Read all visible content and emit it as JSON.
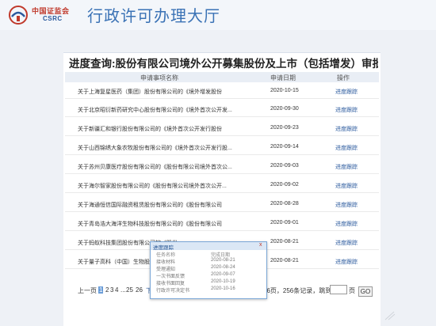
{
  "header": {
    "logo_cn": "中国证监会",
    "logo_en": "CSRC",
    "app_title": "行政许可办理大厅"
  },
  "page": {
    "heading": "进度查询:股份有限公司境外公开募集股份及上市（包括增发）审批"
  },
  "table": {
    "columns": [
      "申请事项名称",
      "申请日期",
      "操作"
    ],
    "rows": [
      {
        "name": "关于上海复星医药（集团）股份有限公司的《境外增发股份",
        "date": "2020-10-15",
        "action": "进度跟踪"
      },
      {
        "name": "关于北京昭衍新药研究中心股份有限公司的《境外首次公开发...",
        "date": "2020-09-30",
        "action": "进度跟踪"
      },
      {
        "name": "关于新疆汇和银行股份有限公司的《境外首次公开发行股份",
        "date": "2020-09-23",
        "action": "进度跟踪"
      },
      {
        "name": "关于山西锦绣大象农牧股份有限公司的《境外首次公开发行股...",
        "date": "2020-09-14",
        "action": "进度跟踪"
      },
      {
        "name": "关于苏州贝康医疗股份有限公司的《股份有限公司境外首次公...",
        "date": "2020-09-03",
        "action": "进度跟踪"
      },
      {
        "name": "关于海尔智家股份有限公司的《股份有限公司境外首次公开...",
        "date": "2020-09-02",
        "action": "进度跟踪"
      },
      {
        "name": "关于海通恒信国际融资租赁股份有限公司的《股份有限公司",
        "date": "2020-08-28",
        "action": "进度跟踪"
      },
      {
        "name": "关于青岛浩大海洋生物科技股份有限公司的《股份有限公司",
        "date": "2020-09-01",
        "action": "进度跟踪"
      },
      {
        "name": "关于蚂蚁科技集团股份有限公司的《股份",
        "date": "2020-08-21",
        "action": "进度跟踪"
      },
      {
        "name": "关于量子高科（中国）生物股",
        "date": "2020-08-21",
        "action": "进度跟踪"
      }
    ]
  },
  "pager": {
    "prev": "上一页",
    "current": "1",
    "p2": "2",
    "p3": "3",
    "p4": "4",
    "dots": "...",
    "p25": "25",
    "p26": "26",
    "next": "下一页",
    "total": "共26页，256条记录，跳到",
    "unit": "页",
    "go": "GO"
  },
  "popup": {
    "title": "进度跟踪",
    "close": "x",
    "col_task": "任务名称",
    "col_date": "完成日期",
    "rows": [
      {
        "task": "接收材料",
        "date": "2020-08-21"
      },
      {
        "task": "受理通知",
        "date": "2020-08-24"
      },
      {
        "task": "一次书面反馈",
        "date": "2020-09-07"
      },
      {
        "task": "接收书面回复",
        "date": "2020-10-19"
      },
      {
        "task": "行政许可决定书",
        "date": "2020-10-16"
      }
    ]
  },
  "colors": {
    "brand_blue": "#3a72b5",
    "link_blue": "#2b5a9e",
    "logo_red": "#c0392b",
    "page_bg": "#eef1f6"
  }
}
